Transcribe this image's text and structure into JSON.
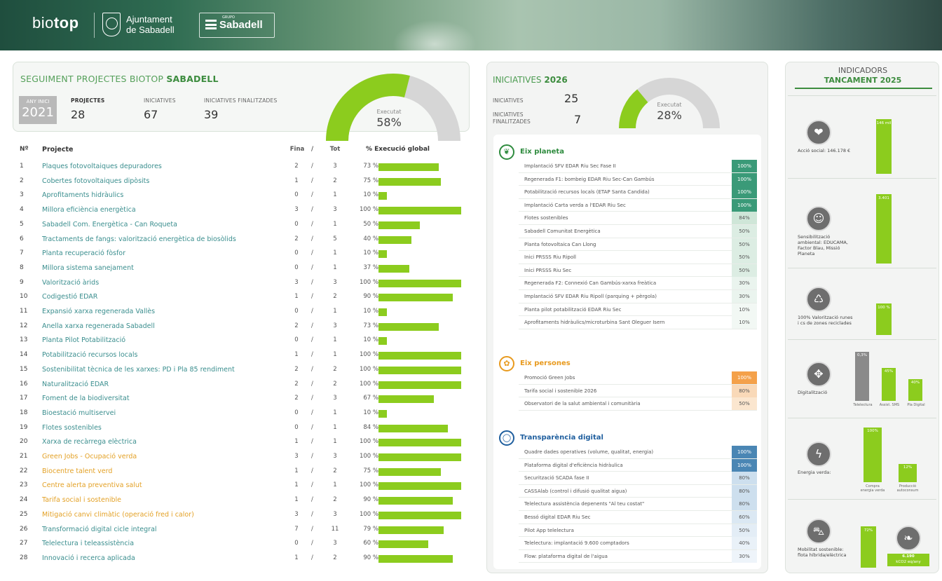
{
  "header": {
    "logo_bio": "bio",
    "logo_top": "top",
    "ajuntament": "Ajuntament",
    "de_sabadell": "de Sabadell",
    "bank_small": "GRUPO",
    "bank": "Sabadell"
  },
  "summary": {
    "title_prefix": "SEGUIMENT PROJECTES BIOTOP ",
    "title_bold": "SABADELL",
    "year_label": "ANY INICI",
    "year_value": "2021",
    "projects_label": "PROJECTES",
    "projects_value": "28",
    "initiatives_label": "INICIATIVES",
    "initiatives_value": "67",
    "finished_label": "INICIATIVES FINALITZADES",
    "finished_value": "39",
    "executed_label": "Executat",
    "executed_value": "58%",
    "executed_fraction": 0.58
  },
  "projects_table": {
    "headers": {
      "n": "Nº",
      "project": "Projecte",
      "fi": "Fina",
      "sep": "/",
      "tot": "Tot",
      "pct": "% Execució global"
    },
    "rows": [
      {
        "n": "1",
        "name": "Plaques fotovoltaiques depuradores",
        "fi": "2",
        "tot": "3",
        "pct": "73 %",
        "v": 73,
        "orange": false
      },
      {
        "n": "2",
        "name": "Cobertes fotovoltaiques dipòsits",
        "fi": "1",
        "tot": "2",
        "pct": "75 %",
        "v": 75,
        "orange": false
      },
      {
        "n": "3",
        "name": "Aprofitaments hidràulics",
        "fi": "0",
        "tot": "1",
        "pct": "10 %",
        "v": 10,
        "orange": false
      },
      {
        "n": "4",
        "name": "Millora eficiència energètica",
        "fi": "3",
        "tot": "3",
        "pct": "100 %",
        "v": 100,
        "orange": false
      },
      {
        "n": "5",
        "name": "Sabadell Com. Energètica - Can Roqueta",
        "fi": "0",
        "tot": "1",
        "pct": "50 %",
        "v": 50,
        "orange": false
      },
      {
        "n": "6",
        "name": "Tractaments de fangs: valorització energètica de biosòlids",
        "fi": "2",
        "tot": "5",
        "pct": "40 %",
        "v": 40,
        "orange": false
      },
      {
        "n": "7",
        "name": "Planta recuperació fòsfor",
        "fi": "0",
        "tot": "1",
        "pct": "10 %",
        "v": 10,
        "orange": false
      },
      {
        "n": "8",
        "name": "Millora sistema sanejament",
        "fi": "0",
        "tot": "1",
        "pct": "37 %",
        "v": 37,
        "orange": false
      },
      {
        "n": "9",
        "name": "Valorització àrids",
        "fi": "3",
        "tot": "3",
        "pct": "100 %",
        "v": 100,
        "orange": false
      },
      {
        "n": "10",
        "name": "Codigestió EDAR",
        "fi": "1",
        "tot": "2",
        "pct": "90 %",
        "v": 90,
        "orange": false
      },
      {
        "n": "11",
        "name": "Expansió xarxa regenerada Vallès",
        "fi": "0",
        "tot": "1",
        "pct": "10 %",
        "v": 10,
        "orange": false
      },
      {
        "n": "12",
        "name": "Anella xarxa regenerada Sabadell",
        "fi": "2",
        "tot": "3",
        "pct": "73 %",
        "v": 73,
        "orange": false
      },
      {
        "n": "13",
        "name": "Planta Pilot Potabilització",
        "fi": "0",
        "tot": "1",
        "pct": "10 %",
        "v": 10,
        "orange": false
      },
      {
        "n": "14",
        "name": "Potabilització recursos locals",
        "fi": "1",
        "tot": "1",
        "pct": "100 %",
        "v": 100,
        "orange": false
      },
      {
        "n": "15",
        "name": "Sostenibilitat tècnica de les xarxes: PD i Pla 85 rendiment",
        "fi": "2",
        "tot": "2",
        "pct": "100 %",
        "v": 100,
        "orange": false
      },
      {
        "n": "16",
        "name": "Naturalització EDAR",
        "fi": "2",
        "tot": "2",
        "pct": "100 %",
        "v": 100,
        "orange": false
      },
      {
        "n": "17",
        "name": "Foment de la biodiversitat",
        "fi": "2",
        "tot": "3",
        "pct": "67 %",
        "v": 67,
        "orange": false
      },
      {
        "n": "18",
        "name": "Bioestació multiservei",
        "fi": "0",
        "tot": "1",
        "pct": "10 %",
        "v": 10,
        "orange": false
      },
      {
        "n": "19",
        "name": "Flotes sostenibles",
        "fi": "0",
        "tot": "1",
        "pct": "84 %",
        "v": 84,
        "orange": false
      },
      {
        "n": "20",
        "name": "Xarxa de recàrrega elèctrica",
        "fi": "1",
        "tot": "1",
        "pct": "100 %",
        "v": 100,
        "orange": false
      },
      {
        "n": "21",
        "name": "Green Jobs - Ocupació verda",
        "fi": "3",
        "tot": "3",
        "pct": "100 %",
        "v": 100,
        "orange": true
      },
      {
        "n": "22",
        "name": "Biocentre talent verd",
        "fi": "1",
        "tot": "2",
        "pct": "75 %",
        "v": 75,
        "orange": true
      },
      {
        "n": "23",
        "name": "Centre alerta preventiva salut",
        "fi": "1",
        "tot": "1",
        "pct": "100 %",
        "v": 100,
        "orange": true
      },
      {
        "n": "24",
        "name": "Tarifa social i sostenible",
        "fi": "1",
        "tot": "2",
        "pct": "90 %",
        "v": 90,
        "orange": true
      },
      {
        "n": "25",
        "name": "Mitigació canvi climàtic (operació fred i calor)",
        "fi": "3",
        "tot": "3",
        "pct": "100 %",
        "v": 100,
        "orange": true
      },
      {
        "n": "26",
        "name": "Transformació digital cicle integral",
        "fi": "7",
        "tot": "11",
        "pct": "79 %",
        "v": 79,
        "orange": false
      },
      {
        "n": "27",
        "name": "Telelectura i teleassistència",
        "fi": "0",
        "tot": "3",
        "pct": "60 %",
        "v": 60,
        "orange": false
      },
      {
        "n": "28",
        "name": "Innovació i recerca aplicada",
        "fi": "1",
        "tot": "2",
        "pct": "90 %",
        "v": 90,
        "orange": false
      }
    ]
  },
  "initiatives": {
    "title_prefix": "INICIATIVES ",
    "title_bold": "2026",
    "iniciatives_label": "INICIATIVES",
    "iniciatives_value": "25",
    "finished_label_1": "INICIATIVES",
    "finished_label_2": "FINALITZADES",
    "finished_value": "7",
    "executed_label": "Executat",
    "executed_value": "28%",
    "executed_fraction": 0.28,
    "sections": [
      {
        "title": "Eix planeta",
        "color": "#2e8b3e",
        "items": [
          {
            "name": "Implantació SFV EDAR Riu Sec Fase II",
            "pct": "100%",
            "bg": "#3a9a78",
            "fg": "#ffffff"
          },
          {
            "name": "Regenerada F1: bombeig EDAR Riu Sec-Can Gambús",
            "pct": "100%",
            "bg": "#3a9a78",
            "fg": "#ffffff"
          },
          {
            "name": "Potabilització recursos locals (ETAP Santa Candida)",
            "pct": "100%",
            "bg": "#3a9a78",
            "fg": "#ffffff"
          },
          {
            "name": "Implantació Carta verda a l'EDAR Riu Sec",
            "pct": "100%",
            "bg": "#3a9a78",
            "fg": "#ffffff"
          },
          {
            "name": "Flotes sostenibles",
            "pct": "84%",
            "bg": "#cfe6d8",
            "fg": "#555555"
          },
          {
            "name": "Sabadell Comunitat Energètica",
            "pct": "50%",
            "bg": "#dcede3",
            "fg": "#555555"
          },
          {
            "name": "Planta fotovoltaica Can Llong",
            "pct": "50%",
            "bg": "#dcede3",
            "fg": "#555555"
          },
          {
            "name": "Inici PRSSS Riu Ripoll",
            "pct": "50%",
            "bg": "#dcede3",
            "fg": "#555555"
          },
          {
            "name": "Inici PRSSS Riu Sec",
            "pct": "50%",
            "bg": "#dcede3",
            "fg": "#555555"
          },
          {
            "name": "Regenerada F2: Connexió Can Gambús-xarxa freàtica",
            "pct": "30%",
            "bg": "#eaf4ee",
            "fg": "#555555"
          },
          {
            "name": "Implantació SFV EDAR Riu Ripoll (parquing + pèrgola)",
            "pct": "30%",
            "bg": "#eaf4ee",
            "fg": "#555555"
          },
          {
            "name": "Planta pilot potabilització EDAR Riu Sec",
            "pct": "10%",
            "bg": "#f2f8f4",
            "fg": "#555555"
          },
          {
            "name": "Aprofitaments hidràulics/microturbina Sant Oleguer Isern",
            "pct": "10%",
            "bg": "#f2f8f4",
            "fg": "#555555"
          }
        ]
      },
      {
        "title": "Eix persones",
        "color": "#e89a1e",
        "items": [
          {
            "name": "Promoció Green Jobs",
            "pct": "100%",
            "bg": "#f4a14a",
            "fg": "#ffffff"
          },
          {
            "name": "Tarifa social i sostenible 2026",
            "pct": "80%",
            "bg": "#f9d9b8",
            "fg": "#555555"
          },
          {
            "name": "Observatori de la salut ambiental i comunitària",
            "pct": "50%",
            "bg": "#fbe6cf",
            "fg": "#555555"
          }
        ]
      },
      {
        "title": "Transparència digital",
        "color": "#1e5e9e",
        "items": [
          {
            "name": "Quadre dades operatives (volume, qualitat, energia)",
            "pct": "100%",
            "bg": "#4a86b4",
            "fg": "#ffffff"
          },
          {
            "name": "Plataforma digital d'eficiència hidràulica",
            "pct": "100%",
            "bg": "#4a86b4",
            "fg": "#ffffff"
          },
          {
            "name": "Securització SCADA fase II",
            "pct": "80%",
            "bg": "#cddfee",
            "fg": "#555555"
          },
          {
            "name": "CASSAlab (control i difusió qualitat aigua)",
            "pct": "80%",
            "bg": "#cddfee",
            "fg": "#555555"
          },
          {
            "name": "Telelectura assistència depenents \"Al teu costat\"",
            "pct": "80%",
            "bg": "#cddfee",
            "fg": "#555555"
          },
          {
            "name": "Bessó digital EDAR Riu Sec",
            "pct": "60%",
            "bg": "#dbe8f3",
            "fg": "#555555"
          },
          {
            "name": "Pilot App telelectura",
            "pct": "50%",
            "bg": "#e3edf6",
            "fg": "#555555"
          },
          {
            "name": "Telelectura: implantació 9.600 comptadors",
            "pct": "40%",
            "bg": "#e9f1f8",
            "fg": "#555555"
          },
          {
            "name": "Flow: plataforma digital de l'aigua",
            "pct": "30%",
            "bg": "#eef4fa",
            "fg": "#555555"
          }
        ]
      }
    ]
  },
  "indicators": {
    "title_1": "INDICADORS",
    "title_2": "TANCAMENT 2025",
    "cells": [
      {
        "caption": "Acció social: 146.178 €",
        "bar_label": "146 mil",
        "fraction": 0.8
      },
      {
        "caption": "Sensibilització ambiental: EDUCAMA, Factor Blau, Missió Planeta",
        "bar_label": "3.401",
        "fraction": 0.92
      },
      {
        "caption": "100% Valorització runes i cs de zones reciclades",
        "bar_label": "100 %",
        "fraction": 0.55
      },
      {
        "caption": "Digitalització",
        "bars": [
          {
            "label": "Telelectura",
            "val": "0,3%",
            "fraction": 0.9,
            "gray": true
          },
          {
            "label": "Assist. SMS",
            "val": "45%",
            "fraction": 0.6,
            "gray": false
          },
          {
            "label": "Pla Digital",
            "val": "40%",
            "fraction": 0.4,
            "gray": false
          }
        ]
      },
      {
        "caption": "Energia verda:",
        "bars": [
          {
            "label": "Compra energia verda",
            "val": "100%",
            "fraction": 0.95,
            "gray": false
          },
          {
            "label": "Producció autoconsum",
            "val": "12%",
            "fraction": 0.32,
            "gray": false
          }
        ]
      },
      {
        "caption": "Mobilitat sostenible: flota híbrida/elèctrica",
        "bar_label": "72%",
        "fraction": 0.7,
        "extra_1": "6.190",
        "extra_2": "kCO2 eq/any"
      }
    ]
  }
}
